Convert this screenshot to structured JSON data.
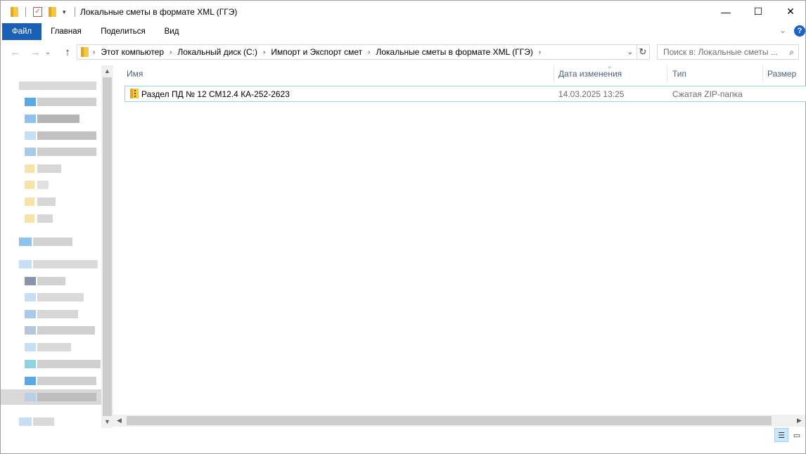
{
  "window": {
    "title": "Локальные сметы в формате XML (ГГЭ)",
    "controls": {
      "minimize": "—",
      "maximize": "☐",
      "close": "✕"
    }
  },
  "quick_access": {
    "properties_glyph": "✓",
    "customize_glyph": "▾"
  },
  "ribbon": {
    "tabs": [
      "Файл",
      "Главная",
      "Поделиться",
      "Вид"
    ],
    "active_tab": "Файл",
    "expand_glyph": "⌄",
    "help_glyph": "?"
  },
  "navigation": {
    "back": "←",
    "forward": "→",
    "recent": "⌄",
    "up": "↑"
  },
  "address_bar": {
    "segments": [
      "Этот компьютер",
      "Локальный диск (C:)",
      "Импорт и Экспорт смет",
      "Локальные сметы в формате XML (ГГЭ)"
    ],
    "separator": "›",
    "dropdown_glyph": "⌄",
    "refresh_glyph": "↻"
  },
  "search": {
    "placeholder": "Поиск в: Локальные сметы ...",
    "icon_glyph": "⌕"
  },
  "file_list": {
    "columns": [
      "Имя",
      "Дата изменения",
      "Тип",
      "Размер"
    ],
    "sort_glyph": "⌄",
    "files": [
      {
        "name": "Раздел ПД № 12 СМ12.4 КА-252-2623",
        "date_modified": "14.03.2025 13:25",
        "type": "Сжатая ZIP-папка",
        "icon": "zip-folder-icon"
      }
    ]
  },
  "scrollbars": {
    "up": "▲",
    "down": "▼",
    "left": "◀",
    "right": "▶"
  },
  "view_buttons": {
    "details": "☰",
    "large_icons": "▭"
  },
  "colors": {
    "accent": "#1a5fb4",
    "selection_border": "#99d1ff",
    "header_text": "#4c607a"
  }
}
